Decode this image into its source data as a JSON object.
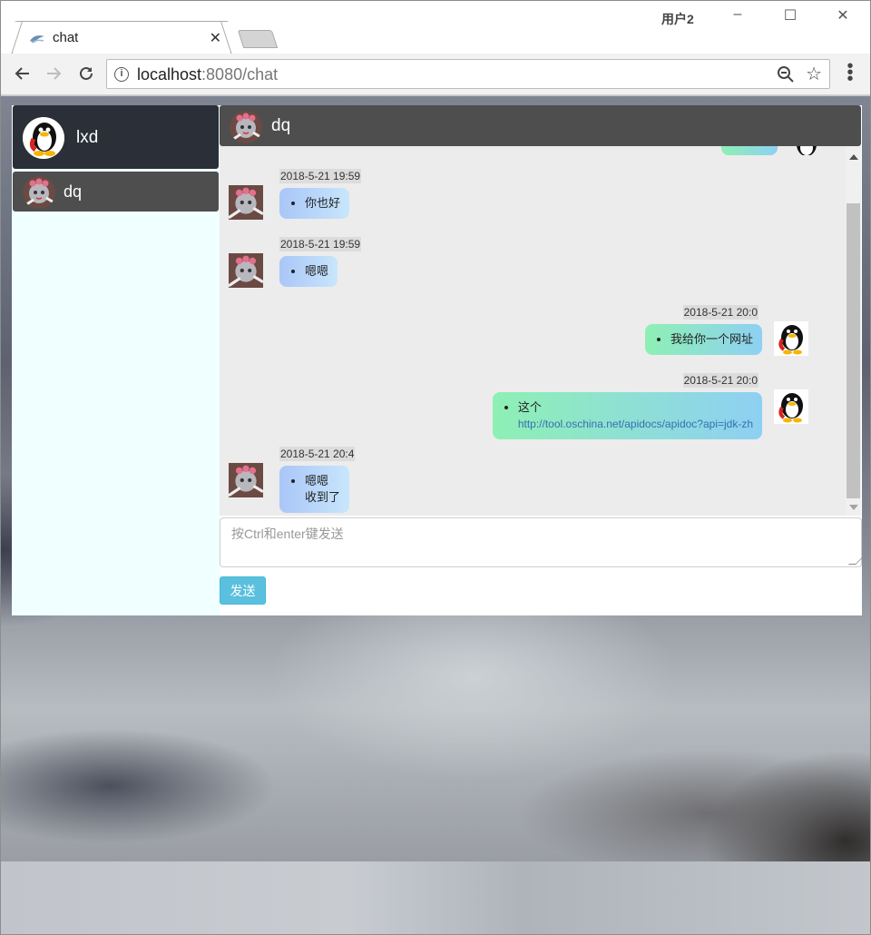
{
  "browser": {
    "tab_title": "chat",
    "profile_name": "用户2",
    "url_host": "localhost",
    "url_path": ":8080/chat",
    "info_icon_char": "i"
  },
  "window_controls": {
    "minimize": "–",
    "maximize": "☐",
    "close": "✕"
  },
  "sidebar": {
    "me_name": "lxd",
    "contacts": [
      {
        "name": "dq"
      }
    ]
  },
  "chat": {
    "partner_name": "dq",
    "messages": [
      {
        "side": "left",
        "time": "2018-5-21 19:59",
        "lines": [
          "你也好"
        ]
      },
      {
        "side": "left",
        "time": "2018-5-21 19:59",
        "lines": [
          "嗯嗯"
        ]
      },
      {
        "side": "right",
        "time": "2018-5-21 20:0",
        "lines": [
          "我给你一个网址"
        ]
      },
      {
        "side": "right",
        "time": "2018-5-21 20:0",
        "lines": [
          "这个"
        ],
        "link": "http://tool.oschina.net/apidocs/apidoc?api=jdk-zh"
      },
      {
        "side": "left",
        "time": "2018-5-21 20:4",
        "lines": [
          "嗯嗯",
          "收到了"
        ]
      }
    ],
    "input_placeholder": "按Ctrl和enter键发送",
    "send_label": "发送"
  },
  "colors": {
    "sidebar_bg": "#f0ffff",
    "me_bg": "#2b2f38",
    "contact_bg": "#4e4e4e",
    "messages_bg": "#ececec",
    "send_button": "#5bc0de",
    "bubble_left": "#a9c6f8",
    "bubble_right": "#8ef0b4"
  },
  "icons": {
    "back": "arrow-left-icon",
    "forward": "arrow-right-icon",
    "reload": "reload-icon",
    "zoom": "zoom-out-icon",
    "bookmark": "star-icon",
    "menu": "kebab-menu-icon"
  }
}
